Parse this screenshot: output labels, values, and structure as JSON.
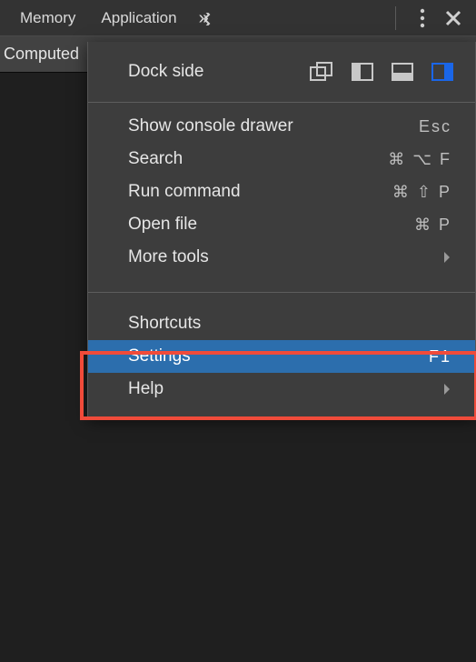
{
  "topbar": {
    "tabs": [
      "Memory",
      "Application"
    ]
  },
  "subbar": {
    "tab": "Computed"
  },
  "dropdown": {
    "dock_label": "Dock side",
    "items_a": [
      {
        "label": "Show console drawer",
        "sc": "Esc"
      },
      {
        "label": "Search",
        "sc": "⌘ ⌥ F"
      },
      {
        "label": "Run command",
        "sc": "⌘ ⇧ P"
      },
      {
        "label": "Open file",
        "sc": "⌘ P"
      },
      {
        "label": "More tools",
        "sc": "",
        "sub": true
      }
    ],
    "items_b": [
      {
        "label": "Shortcuts",
        "sc": ""
      },
      {
        "label": "Settings",
        "sc": "F1",
        "selected": true
      },
      {
        "label": "Help",
        "sc": "",
        "sub": true
      }
    ]
  }
}
